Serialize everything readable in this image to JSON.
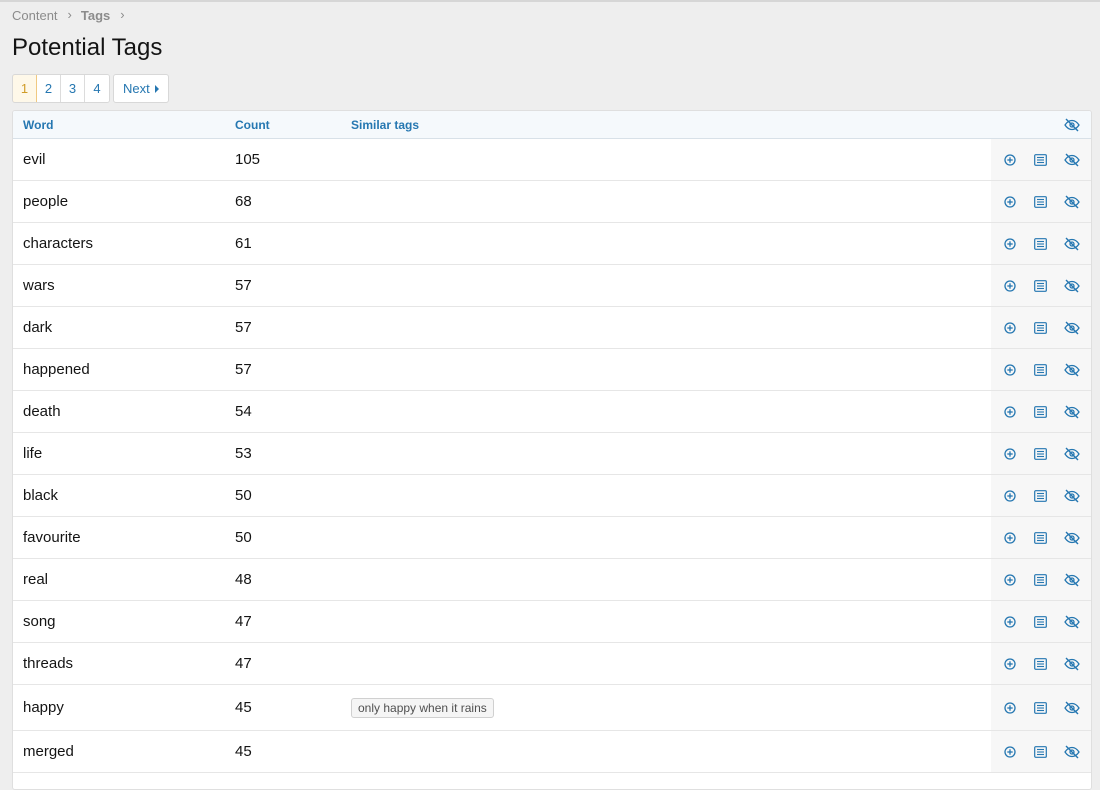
{
  "breadcrumb": {
    "items": [
      "Content",
      "Tags"
    ]
  },
  "page": {
    "title": "Potential Tags"
  },
  "pagination": {
    "pages": [
      "1",
      "2",
      "3",
      "4"
    ],
    "current": "1",
    "next_label": "Next"
  },
  "table": {
    "headers": {
      "word": "Word",
      "count": "Count",
      "similar": "Similar tags"
    },
    "rows": [
      {
        "word": "evil",
        "count": "105",
        "similar": []
      },
      {
        "word": "people",
        "count": "68",
        "similar": []
      },
      {
        "word": "characters",
        "count": "61",
        "similar": []
      },
      {
        "word": "wars",
        "count": "57",
        "similar": []
      },
      {
        "word": "dark",
        "count": "57",
        "similar": []
      },
      {
        "word": "happened",
        "count": "57",
        "similar": []
      },
      {
        "word": "death",
        "count": "54",
        "similar": []
      },
      {
        "word": "life",
        "count": "53",
        "similar": []
      },
      {
        "word": "black",
        "count": "50",
        "similar": []
      },
      {
        "word": "favourite",
        "count": "50",
        "similar": []
      },
      {
        "word": "real",
        "count": "48",
        "similar": []
      },
      {
        "word": "song",
        "count": "47",
        "similar": []
      },
      {
        "word": "threads",
        "count": "47",
        "similar": []
      },
      {
        "word": "happy",
        "count": "45",
        "similar": [
          "only happy when it rains"
        ]
      },
      {
        "word": "merged",
        "count": "45",
        "similar": []
      }
    ]
  },
  "icons": {
    "add": "plus-circle-icon",
    "details": "list-icon",
    "ignore": "eye-slash-icon",
    "header_toggle": "eye-slash-icon",
    "breadcrumb_separator": "chevron-right-icon",
    "next_arrow": "caret-right-icon"
  },
  "colors": {
    "link": "#2577b1",
    "current_page_bg": "#fef8e9",
    "current_page_text": "#d09c27"
  }
}
